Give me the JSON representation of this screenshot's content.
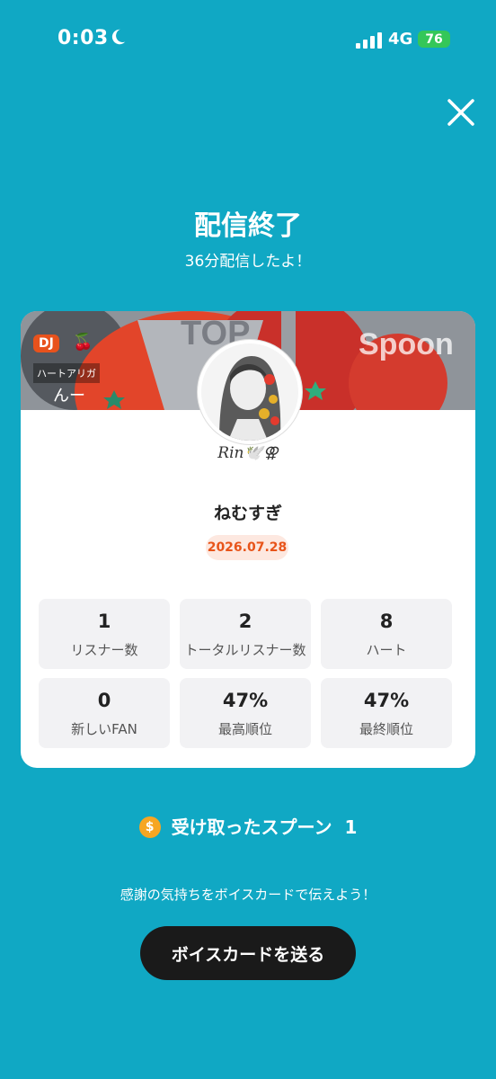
{
  "status_bar": {
    "time": "0:03",
    "network": "4G",
    "battery": "76"
  },
  "header": {
    "title": "配信終了",
    "subtitle": "36分配信したよ！"
  },
  "banner": {
    "dj_tag": "DJ",
    "heart_label": "ハートアリガ",
    "partial_text": "んー",
    "top_text": "TOP",
    "brand": "Spoon"
  },
  "profile": {
    "username": "Rin🕊️⚢",
    "stream_title": "ねむすぎ",
    "date": "2026.07.28"
  },
  "stats": [
    {
      "value": "1",
      "label": "リスナー数"
    },
    {
      "value": "2",
      "label": "トータルリスナー数"
    },
    {
      "value": "8",
      "label": "ハート"
    },
    {
      "value": "0",
      "label": "新しいFAN"
    },
    {
      "value": "47%",
      "label": "最高順位"
    },
    {
      "value": "47%",
      "label": "最終順位"
    }
  ],
  "spoons": {
    "label": "受け取ったスプーン",
    "count": "1"
  },
  "thanks_text": "感謝の気持ちをボイスカードで伝えよう！",
  "voice_button": "ボイスカードを送る",
  "colors": {
    "background": "#10a8c4",
    "date_text": "#e8541a",
    "button": "#1a1a1a",
    "coin": "#f6a623"
  }
}
